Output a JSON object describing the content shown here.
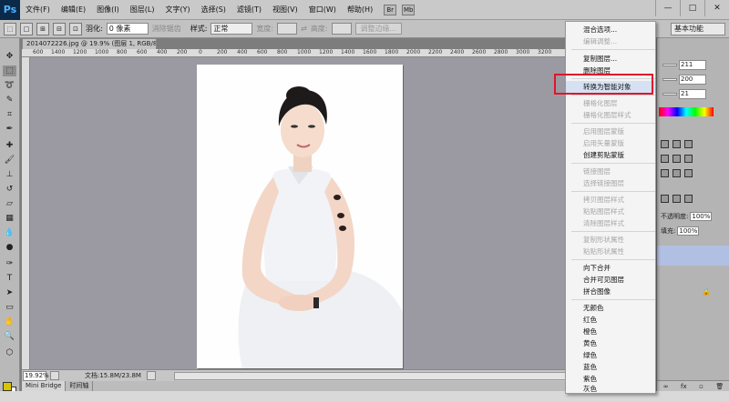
{
  "menubar": {
    "logo": "Ps",
    "items": [
      "文件(F)",
      "编辑(E)",
      "图像(I)",
      "图层(L)",
      "文字(Y)",
      "选择(S)",
      "滤镜(T)",
      "视图(V)",
      "窗口(W)",
      "帮助(H)"
    ],
    "win_min": "—",
    "win_max": "□",
    "win_close": "✕"
  },
  "optbar": {
    "feather_label": "羽化:",
    "feather_value": "0 像素",
    "antialias_label": "消除锯齿",
    "style_label": "样式:",
    "style_value": "正常",
    "width_label": "宽度:",
    "height_label": "高度:",
    "refine_edge": "调整边缘...",
    "workspace": "基本功能"
  },
  "document": {
    "tab_title": "2014072226.jpg @ 19.9% (图层 1, RGB/8) *",
    "tab_close": "×",
    "ruler_ticks": [
      "600",
      "1400",
      "1200",
      "1000",
      "800",
      "600",
      "400",
      "200",
      "0",
      "200",
      "400",
      "600",
      "800",
      "1000",
      "1200",
      "1400",
      "1600",
      "1800",
      "2000",
      "2200",
      "2400",
      "2600",
      "2800",
      "3000",
      "3200",
      "3400",
      "3600",
      "3800",
      "4000",
      "4200",
      "4400",
      "4600"
    ],
    "zoom": "19.92%",
    "info": "文档:15.8M/23.8M"
  },
  "bottom_tabs": [
    "Mini Bridge",
    "时间轴"
  ],
  "right_panel": {
    "field1": "211",
    "field2": "200",
    "field3": "21",
    "opacity_label": "不透明度:",
    "opacity_value": "100%",
    "fill_label": "填充:",
    "fill_value": "100%",
    "lock": "🔒"
  },
  "context_menu": {
    "items": [
      {
        "label": "混合选项...",
        "enabled": true
      },
      {
        "label": "编辑调整...",
        "enabled": false
      },
      {
        "label": "复制图层...",
        "enabled": true
      },
      {
        "label": "删除图层",
        "enabled": true
      },
      {
        "label": "转换为智能对象",
        "enabled": true,
        "highlighted": true
      },
      {
        "label": "栅格化图层",
        "enabled": false
      },
      {
        "label": "栅格化图层样式",
        "enabled": false
      },
      {
        "label": "启用图层蒙版",
        "enabled": false
      },
      {
        "label": "启用矢量蒙版",
        "enabled": false
      },
      {
        "label": "创建剪贴蒙版",
        "enabled": true
      },
      {
        "label": "链接图层",
        "enabled": false
      },
      {
        "label": "选择链接图层",
        "enabled": false
      },
      {
        "label": "拷贝图层样式",
        "enabled": false
      },
      {
        "label": "粘贴图层样式",
        "enabled": false
      },
      {
        "label": "清除图层样式",
        "enabled": false
      },
      {
        "label": "复制形状属性",
        "enabled": false
      },
      {
        "label": "粘贴形状属性",
        "enabled": false
      },
      {
        "label": "向下合并",
        "enabled": true
      },
      {
        "label": "合并可见图层",
        "enabled": true
      },
      {
        "label": "拼合图像",
        "enabled": true
      },
      {
        "label": "无颜色",
        "enabled": true
      },
      {
        "label": "红色",
        "enabled": true
      },
      {
        "label": "橙色",
        "enabled": true
      },
      {
        "label": "黄色",
        "enabled": true
      },
      {
        "label": "绿色",
        "enabled": true
      },
      {
        "label": "蓝色",
        "enabled": true
      },
      {
        "label": "紫色",
        "enabled": true
      },
      {
        "label": "灰色",
        "enabled": true
      }
    ]
  },
  "colors": {
    "highlight_box": "#e0142a",
    "foreground_swatch": "#d8c400",
    "layer_selection": "#b1bfe2"
  }
}
